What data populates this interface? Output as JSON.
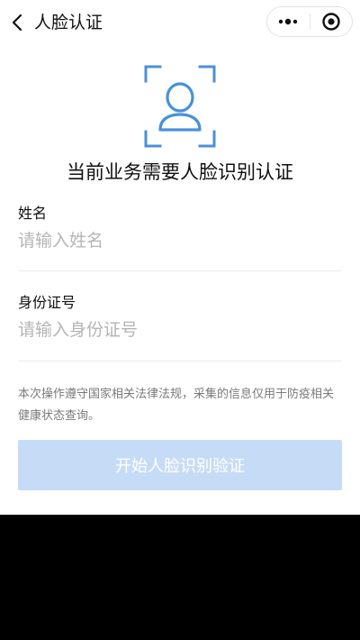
{
  "header": {
    "title": "人脸认证"
  },
  "main": {
    "headline": "当前业务需要人脸识别认证",
    "name_field": {
      "label": "姓名",
      "value": "",
      "placeholder": "请输入姓名"
    },
    "id_field": {
      "label": "身份证号",
      "value": "",
      "placeholder": "请输入身份证号"
    },
    "notice": "本次操作遵守国家相关法律法规，采集的信息仅用于防疫相关健康状态查询。",
    "start_button": "开始人脸识别验证"
  },
  "icons": {
    "back": "chevron-left-icon",
    "more": "more-dots-icon",
    "close": "target-close-icon",
    "face": "face-scan-icon"
  },
  "colors": {
    "accent": "#4a90d9",
    "button_disabled": "#c6dcf6",
    "placeholder": "#b5b5b5",
    "notice_text": "#7a7a7a"
  }
}
